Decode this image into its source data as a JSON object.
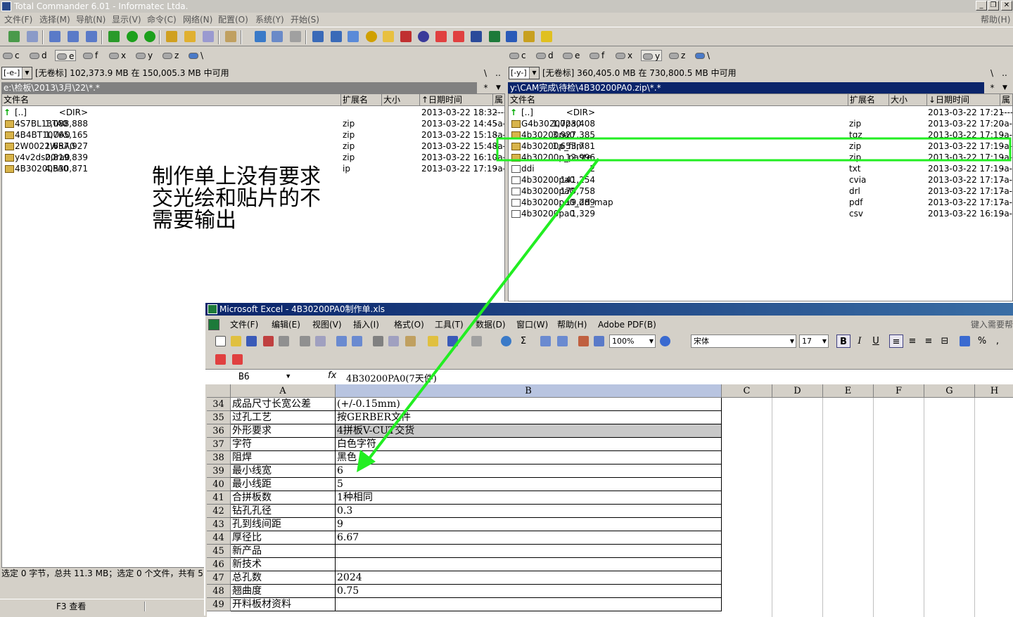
{
  "titlebar": {
    "title": "Total Commander 6.01 - Informatec Ltda.",
    "help": "帮助(H)"
  },
  "menu": [
    "文件(F)",
    "选择(M)",
    "导航(N)",
    "显示(V)",
    "命令(C)",
    "网络(N)",
    "配置(O)",
    "系统(Y)",
    "开始(S)"
  ],
  "left": {
    "drives": [
      "c",
      "d",
      "e",
      "f",
      "x",
      "y",
      "z",
      "\\"
    ],
    "selected_drive": "e",
    "combo": "[-e-]",
    "freeinfo": "[无卷标]  102,373.9 MB 在 150,005.3 MB 中可用",
    "path": "e:\\检板\\2013\\3月\\22\\*.*",
    "headers": {
      "name": "文件名",
      "ext": "扩展名",
      "size": "大小",
      "date": "↑日期时间",
      "attr": "属"
    },
    "files": [
      {
        "name": "[..]",
        "ext": "",
        "size": "<DIR>",
        "date": "2013-03-22 18:32",
        "attr": "----"
      },
      {
        "name": "4S7BL13TA0",
        "ext": "zip",
        "size": "1,088,888",
        "date": "2013-03-22 14:45",
        "attr": "-a-"
      },
      {
        "name": "4B4BT10UA0",
        "ext": "zip",
        "size": "1,765,165",
        "date": "2013-03-22 15:18",
        "attr": "-a-"
      },
      {
        "name": "2W0022WRA0",
        "ext": "zip",
        "size": "1,657,927",
        "date": "2013-03-22 15:48",
        "attr": "-a-"
      },
      {
        "name": "y4v2ds00ra0",
        "ext": "zip",
        "size": "2,819,839",
        "date": "2013-03-22 16:10",
        "attr": "-a-"
      },
      {
        "name": "4B30200PA0",
        "ext": "ip",
        "size": "4,530,871",
        "date": "2013-03-22 17:19",
        "attr": "-a-"
      }
    ],
    "status": "选定 0 字节，总共 11.3 MB；选定 0 个文件，共有 5",
    "fkey": "F3 查看"
  },
  "right": {
    "drives": [
      "c",
      "d",
      "e",
      "f",
      "x",
      "y",
      "z",
      "\\"
    ],
    "selected_drive": "y",
    "combo": "[-y-]",
    "freeinfo": "[无卷标]  360,405.0 MB 在 730,800.5 MB 中可用",
    "path": "y:\\CAM完成\\待检\\4B30200PA0.zip\\*.*",
    "headers": {
      "name": "文件名",
      "ext": "扩展名",
      "size": "大小",
      "date": "↓日期时间",
      "attr": "属"
    },
    "files": [
      {
        "name": "[..]",
        "ext": "",
        "size": "<DIR>",
        "date": "2013-03-22 17:21",
        "attr": "----"
      },
      {
        "name": "G4b30200pa0",
        "ext": "zip",
        "size": "1,723,408",
        "date": "2013-03-22 17:20",
        "attr": "-a-"
      },
      {
        "name": "4b30200pa0",
        "ext": "tgz",
        "size": "3,927,385",
        "date": "2013-03-22 17:19",
        "attr": "-a-"
      },
      {
        "name": "4b30200p_film",
        "ext": "zip",
        "size": "1,653,781",
        "date": "2013-03-22 17:19",
        "attr": "-a-"
      },
      {
        "name": "4b30200p_paste",
        "ext": "zip",
        "size": "12,996",
        "date": "2013-03-22 17:19",
        "attr": "-a-"
      },
      {
        "name": "ddi",
        "ext": "txt",
        "size": "2",
        "date": "2013-03-22 17:19",
        "attr": "-a-"
      },
      {
        "name": "4b30200pa0",
        "ext": "cvia",
        "size": "141,254",
        "date": "2013-03-22 17:17",
        "attr": "-a-"
      },
      {
        "name": "4b30200pa0",
        "ext": "drl",
        "size": "179,758",
        "date": "2013-03-22 17:17",
        "attr": "-a-"
      },
      {
        "name": "4b30200pa0_drl_map",
        "ext": "pdf",
        "size": "19,289",
        "date": "2013-03-22 17:17",
        "attr": "-a-"
      },
      {
        "name": "4b30200pa0",
        "ext": "csv",
        "size": "1,329",
        "date": "2013-03-22 16:19",
        "attr": "-a-"
      }
    ]
  },
  "annotation": [
    "制作单上没有要求",
    "交光绘和贴片的不",
    "需要输出"
  ],
  "highlight_color": "#22ee22",
  "excel": {
    "title": "Microsoft Excel - 4B30200PA0制作单.xls",
    "menu": [
      "文件(F)",
      "编辑(E)",
      "视图(V)",
      "插入(I)",
      "格式(O)",
      "工具(T)",
      "数据(D)",
      "窗口(W)",
      "帮助(H)",
      "Adobe PDF(B)"
    ],
    "help_box": "键入需要帮",
    "zoom": "100%",
    "font": "宋体",
    "font_size": "17",
    "namebox": "B6",
    "fx": "fx",
    "formula": "4B30200PA0(7天件)",
    "columns": [
      "A",
      "B",
      "C",
      "D",
      "E",
      "F",
      "G",
      "H"
    ],
    "rows": [
      {
        "n": "34",
        "a": "成品尺寸长宽公差",
        "b": "(+/-0.15mm)"
      },
      {
        "n": "35",
        "a": "过孔工艺",
        "b": "按GERBER文件"
      },
      {
        "n": "36",
        "a": "外形要求",
        "b": "4拼板V-CUT交货"
      },
      {
        "n": "37",
        "a": "字符",
        "b": "白色字符"
      },
      {
        "n": "38",
        "a": "阻焊",
        "b": "黑色"
      },
      {
        "n": "39",
        "a": "最小线宽",
        "b": "6"
      },
      {
        "n": "40",
        "a": "最小线距",
        "b": "5"
      },
      {
        "n": "41",
        "a": "合拼板数",
        "b": "1种相同"
      },
      {
        "n": "42",
        "a": "钻孔孔径",
        "b": "0.3"
      },
      {
        "n": "43",
        "a": "孔到线间距",
        "b": "9"
      },
      {
        "n": "44",
        "a": "厚径比",
        "b": "6.67"
      },
      {
        "n": "45",
        "a": "新产品",
        "b": ""
      },
      {
        "n": "46",
        "a": "新技术",
        "b": ""
      },
      {
        "n": "47",
        "a": "总孔数",
        "b": "2024"
      },
      {
        "n": "48",
        "a": "翘曲度",
        "b": "0.75"
      },
      {
        "n": "49",
        "a": "开料板材资料",
        "b": ""
      }
    ]
  }
}
